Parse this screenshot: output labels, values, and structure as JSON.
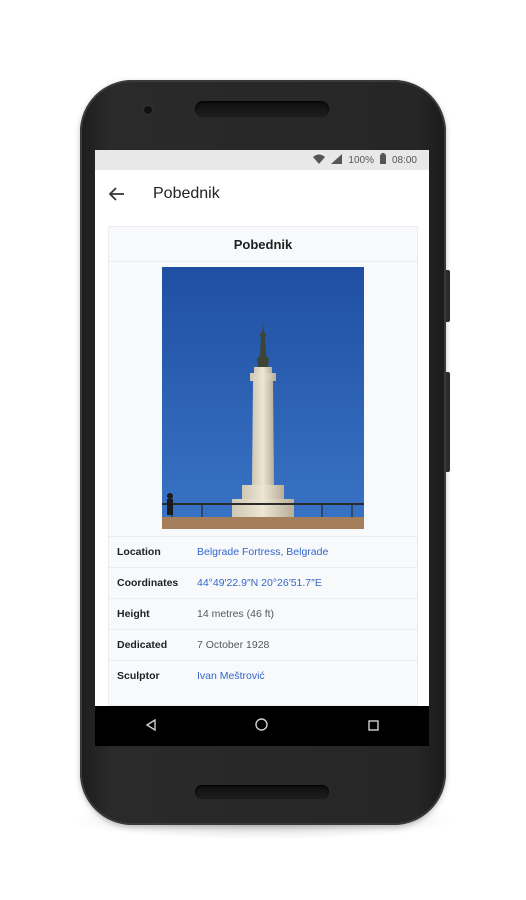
{
  "status_bar": {
    "battery": "100%",
    "time": "08:00",
    "wifi_icon": "wifi-icon",
    "signal_icon": "cell-signal-icon",
    "battery_icon": "battery-icon"
  },
  "app_bar": {
    "back_icon": "arrow-back-icon",
    "title": "Pobednik"
  },
  "infobox": {
    "title": "Pobednik",
    "rows": [
      {
        "label": "Location",
        "value": "Belgrade Fortress, Belgrade"
      },
      {
        "label": "Coordinates",
        "value": "44°49′22.9″N 20°26′51.7″E"
      },
      {
        "label": "Height",
        "value": "14 metres (46 ft)"
      },
      {
        "label": "Dedicated",
        "value": "7 October 1928"
      },
      {
        "label": "Sculptor",
        "value": "Ivan Meštrović"
      }
    ]
  },
  "nav_bar": {
    "back_icon": "nav-back-icon",
    "home_icon": "nav-home-icon",
    "recents_icon": "nav-recents-icon"
  },
  "colors": {
    "link": "#3366cc",
    "sky": "#2f62b4",
    "phone_body": "#262626"
  }
}
